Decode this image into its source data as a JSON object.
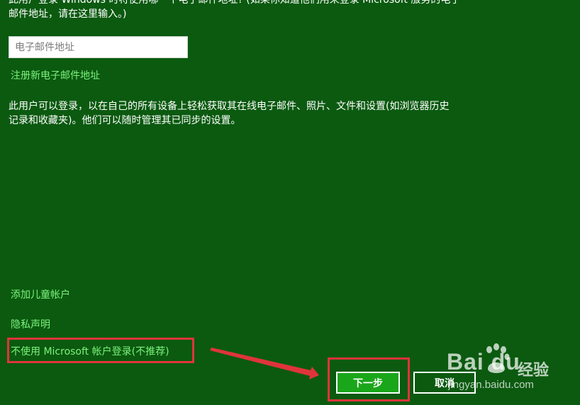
{
  "intro_text": "此用户登录 Windows 时将使用哪一个电子邮件地址? (如果你知道他们用来登录 Microsoft 服务的电子邮件地址，请在这里输入。)",
  "email": {
    "placeholder": "电子邮件地址",
    "value": ""
  },
  "links": {
    "register": "注册新电子邮件地址",
    "add_child": "添加儿童帐户",
    "privacy": "隐私声明",
    "no_ms_account": "不使用 Microsoft 帐户登录(不推荐)"
  },
  "description": "此用户可以登录，以在自己的所有设备上轻松获取其在线电子邮件、照片、文件和设置(如浏览器历史记录和收藏夹)。他们可以随时管理其已同步的设置。",
  "buttons": {
    "next": "下一步",
    "cancel": "取消"
  },
  "watermark": {
    "brand": "Bai du",
    "jingyan": "经验",
    "url": "jingyan.baidu.com"
  },
  "colors": {
    "background": "#0b5a10",
    "link": "#7cf27c",
    "primary_button": "#1aa61a",
    "annotation": "#e0343a"
  }
}
